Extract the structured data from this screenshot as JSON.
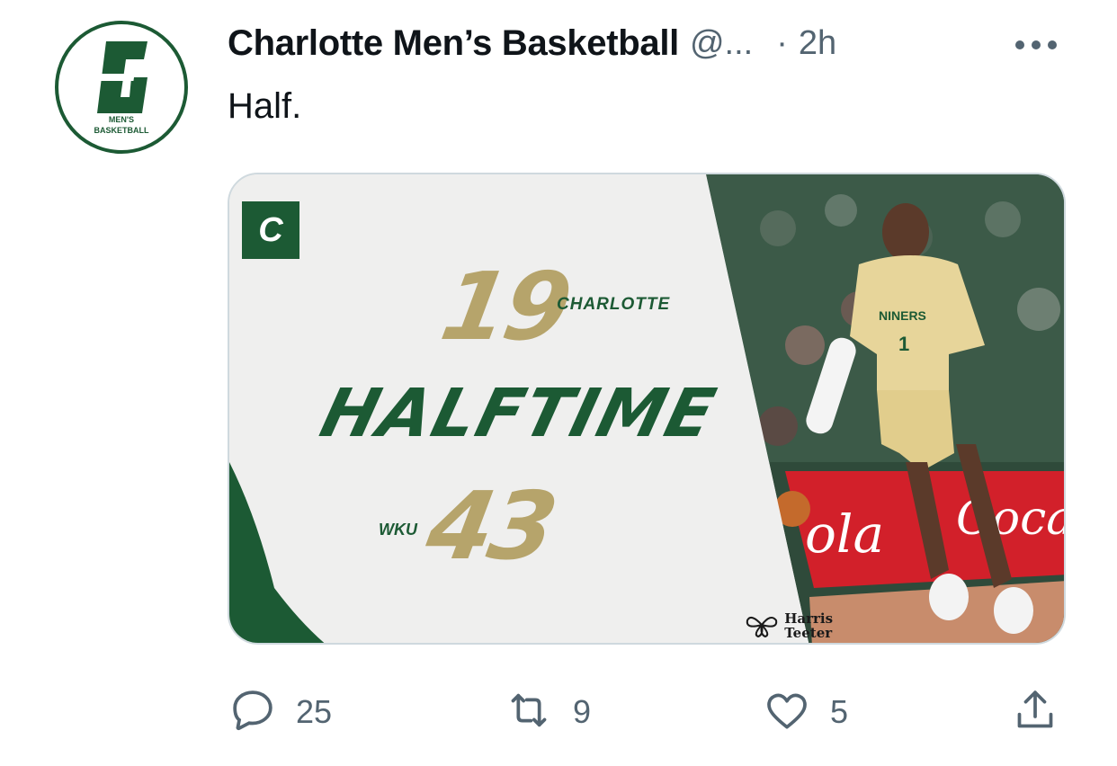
{
  "author": {
    "name": "Charlotte Men’s Basketball",
    "handle": "@...",
    "time": "2h",
    "avatar_text": [
      "MEN'S",
      "BASKETBALL"
    ]
  },
  "tweet": {
    "text": "Half."
  },
  "graphic": {
    "home_score": "19",
    "home_team": "CHARLOTTE",
    "headline": "HALFTIME",
    "away_score": "43",
    "away_team": "WKU",
    "sponsor_line1": "Harris",
    "sponsor_line2": "Teeter",
    "jersey_team": "NINERS",
    "jersey_number": "1",
    "signage": [
      "ola",
      "Coca-C"
    ]
  },
  "actions": {
    "reply_count": "25",
    "retweet_count": "9",
    "like_count": "5"
  },
  "colors": {
    "charlotte_green": "#1c5a34",
    "gold": "#b6a46b",
    "text_secondary": "#536471"
  },
  "icons": [
    "more-icon",
    "reply-icon",
    "retweet-icon",
    "like-icon",
    "share-icon"
  ]
}
